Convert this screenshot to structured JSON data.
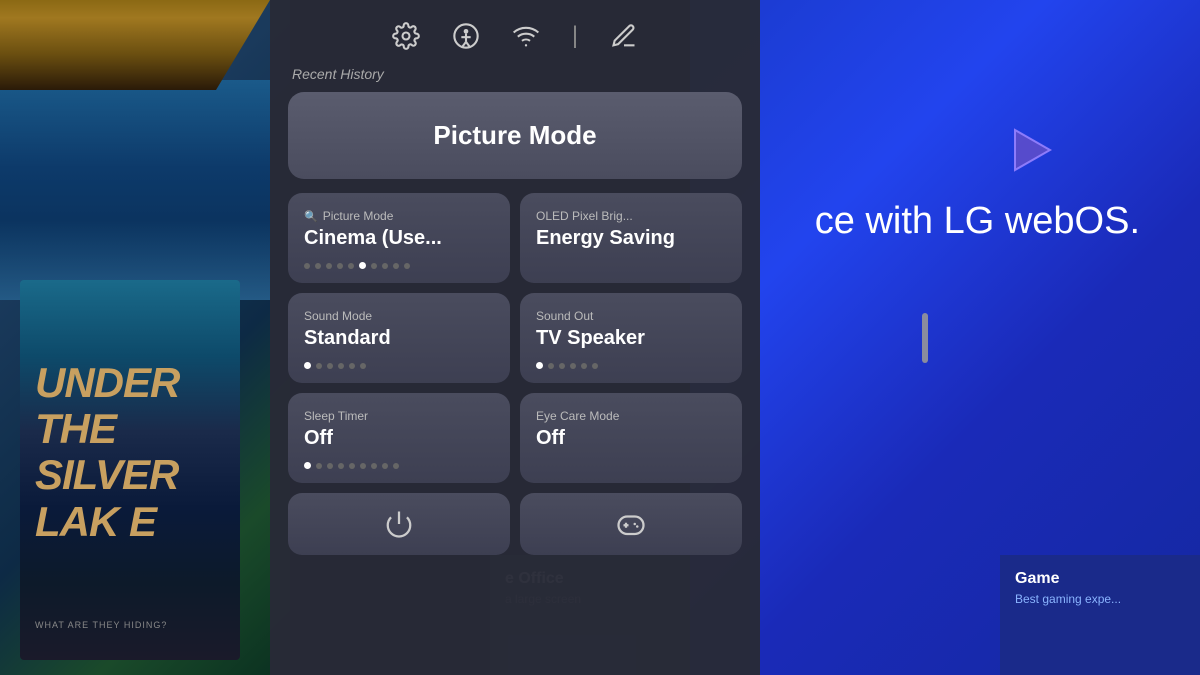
{
  "background": {
    "left_bg_color": "#1a3a5c",
    "right_bg_color": "#1a3acc"
  },
  "header": {
    "recent_history_label": "Recent History"
  },
  "top_icons": [
    {
      "name": "settings-icon",
      "symbol": "gear"
    },
    {
      "name": "accessibility-icon",
      "symbol": "person-circle"
    },
    {
      "name": "wifi-icon",
      "symbol": "wifi"
    },
    {
      "name": "divider",
      "symbol": "|"
    },
    {
      "name": "edit-icon",
      "symbol": "pencil"
    }
  ],
  "picture_mode_button": {
    "label": "Picture Mode"
  },
  "settings_tiles": [
    {
      "id": "picture-mode-tile",
      "label": "Picture Mode",
      "label_icon": "search",
      "value": "Cinema (Use...",
      "dots": [
        false,
        false,
        false,
        false,
        false,
        true,
        false,
        false,
        false,
        false
      ]
    },
    {
      "id": "oled-pixel-tile",
      "label": "OLED Pixel Brig...",
      "label_icon": null,
      "value": "Energy Saving",
      "dots": []
    },
    {
      "id": "sound-mode-tile",
      "label": "Sound Mode",
      "label_icon": null,
      "value": "Standard",
      "dots": [
        true,
        false,
        false,
        false,
        false,
        false
      ]
    },
    {
      "id": "sound-out-tile",
      "label": "Sound Out",
      "label_icon": null,
      "value": "TV Speaker",
      "dots": [
        true,
        false,
        false,
        false,
        false,
        false
      ]
    },
    {
      "id": "sleep-timer-tile",
      "label": "Sleep Timer",
      "label_icon": null,
      "value": "Off",
      "dots": [
        true,
        false,
        false,
        false,
        false,
        false,
        false,
        false,
        false
      ]
    },
    {
      "id": "eye-care-tile",
      "label": "Eye Care Mode",
      "label_icon": null,
      "value": "Off",
      "dots": []
    }
  ],
  "bottom_icons": [
    {
      "name": "power-icon",
      "symbol": "power"
    },
    {
      "name": "gamepad-icon",
      "symbol": "gamepad"
    }
  ],
  "poster": {
    "lines": [
      "UNDER",
      "THE",
      "SILVER",
      "LAK E"
    ],
    "subtitle": "WHAT ARE THEY HIDING?"
  },
  "lg_text": "ce with LG webOS.",
  "office_card": {
    "title": "e Office",
    "subtitle": "a large screen"
  },
  "game_card": {
    "title": "Game",
    "subtitle": "Best gaming expe..."
  }
}
